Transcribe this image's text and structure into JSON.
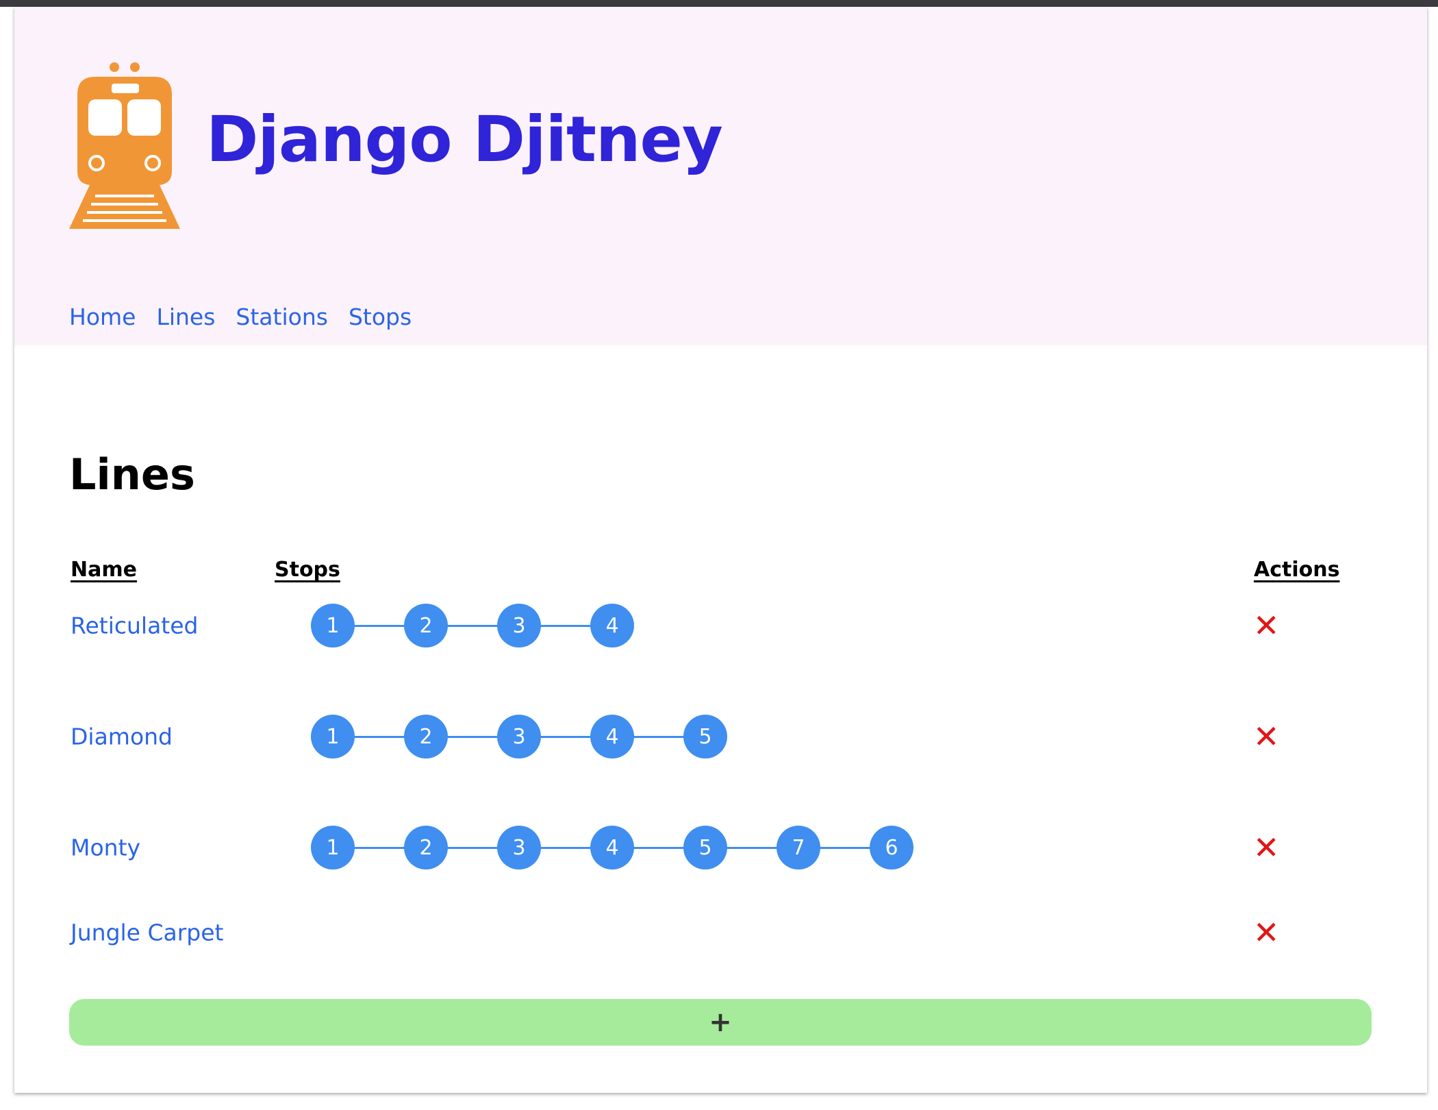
{
  "site": {
    "title": "Django Djitney",
    "colors": {
      "title": "#2f24d8",
      "link": "#2a64e6",
      "header_bg": "#fbf2fb",
      "logo": "#f19636",
      "stop": "#3f8ef0",
      "delete": "#e11616",
      "add_bg": "#a5eb9b"
    }
  },
  "nav": [
    "Home",
    "Lines",
    "Stations",
    "Stops"
  ],
  "page": {
    "title": "Lines"
  },
  "table": {
    "headers": {
      "name": "Name",
      "stops": "Stops",
      "actions": "Actions"
    },
    "rows": [
      {
        "name": "Reticulated",
        "stops": [
          "1",
          "2",
          "3",
          "4"
        ]
      },
      {
        "name": "Diamond",
        "stops": [
          "1",
          "2",
          "3",
          "4",
          "5"
        ]
      },
      {
        "name": "Monty",
        "stops": [
          "1",
          "2",
          "3",
          "4",
          "5",
          "7",
          "6"
        ]
      },
      {
        "name": "Jungle Carpet",
        "stops": []
      }
    ],
    "delete_icon": "close-icon",
    "delete_glyph": "✕"
  },
  "add_button": {
    "label": "+"
  }
}
